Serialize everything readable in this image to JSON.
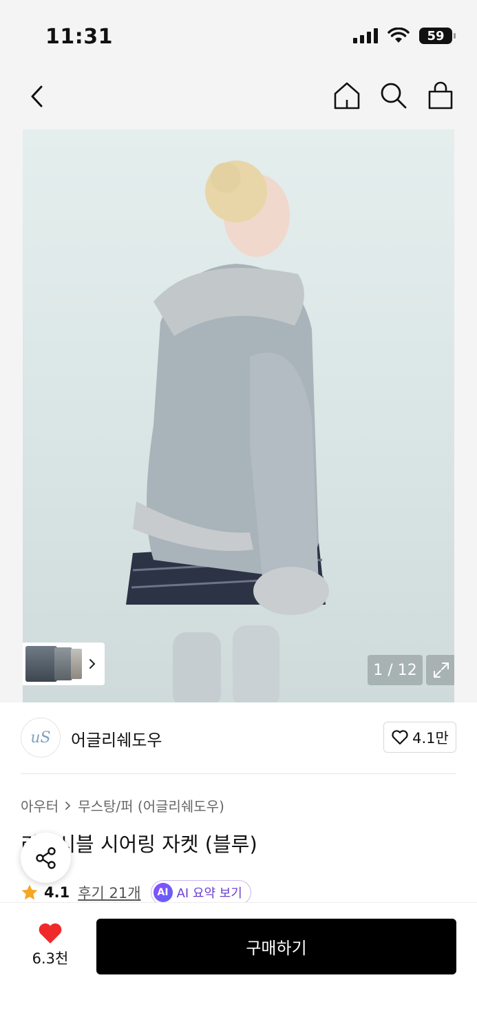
{
  "status_bar": {
    "time": "11:31",
    "battery": "59"
  },
  "nav": {
    "back_icon": "chevron-left-icon",
    "home_icon": "home-icon",
    "search_icon": "search-icon",
    "cart_icon": "shopping-bag-icon"
  },
  "gallery": {
    "counter": "1 / 12",
    "expand_icon": "expand-icon",
    "thumbnail_chevron_icon": "chevron-right-icon"
  },
  "brand": {
    "logo_text": "uS",
    "name": "어글리쉐도우",
    "likes": "4.1만",
    "like_icon": "heart-outline-icon"
  },
  "product": {
    "breadcrumb": [
      "아우터",
      "무스탕/퍼 (어글리쉐도우)"
    ],
    "title": "리버시블 시어링 자켓 (블루)",
    "rating": "4.1",
    "reviews": "후기 21개",
    "ai_badge": "AI",
    "ai_summary_label": "AI 요약 보기"
  },
  "bottom_bar": {
    "wish_count": "6.3천",
    "buy_label": "구매하기"
  },
  "colors": {
    "accent_heart": "#f02a2a",
    "star": "#f5a623",
    "ai_purple": "#6a3fd1",
    "buy_button": "#000000"
  }
}
